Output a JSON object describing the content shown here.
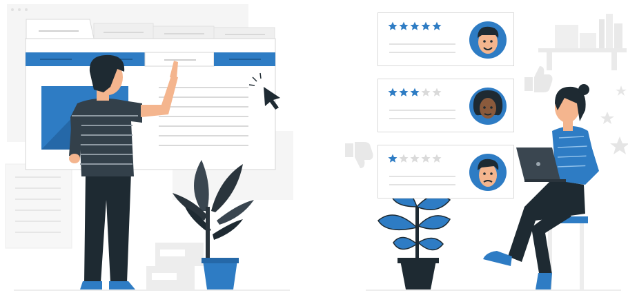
{
  "colors": {
    "accent": "#2E7CC4",
    "dark": "#1E2A32",
    "skin_light": "#F4B58E",
    "skin_dark": "#8A5A3C",
    "line": "#E2E2E2",
    "panel": "#F4F4F4"
  },
  "reviews": [
    {
      "rating": 5,
      "max": 5
    },
    {
      "rating": 3,
      "max": 5
    },
    {
      "rating": 1,
      "max": 5
    }
  ],
  "icons": [
    "cursor-arrow-icon",
    "thumbs-up-icon",
    "thumbs-down-icon",
    "star-icon",
    "laptop-icon",
    "plant-icon"
  ]
}
